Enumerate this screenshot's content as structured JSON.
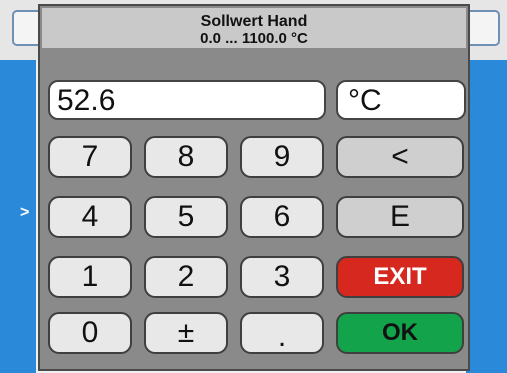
{
  "dialog": {
    "title": "Sollwert Hand",
    "range": "0.0 ... 1100.0 °C",
    "value": "52.6",
    "unit": "°C"
  },
  "background": {
    "side_glyph": ">"
  },
  "keys": {
    "k7": "7",
    "k8": "8",
    "k9": "9",
    "back": "<",
    "k4": "4",
    "k5": "5",
    "k6": "6",
    "enter": "E",
    "k1": "1",
    "k2": "2",
    "k3": "3",
    "exit": "EXIT",
    "k0": "0",
    "sign": "±",
    "dot": ".",
    "ok": "OK"
  },
  "colors": {
    "exit": "#d6281f",
    "ok": "#13a34a",
    "background_blue": "#2a8ad9"
  }
}
